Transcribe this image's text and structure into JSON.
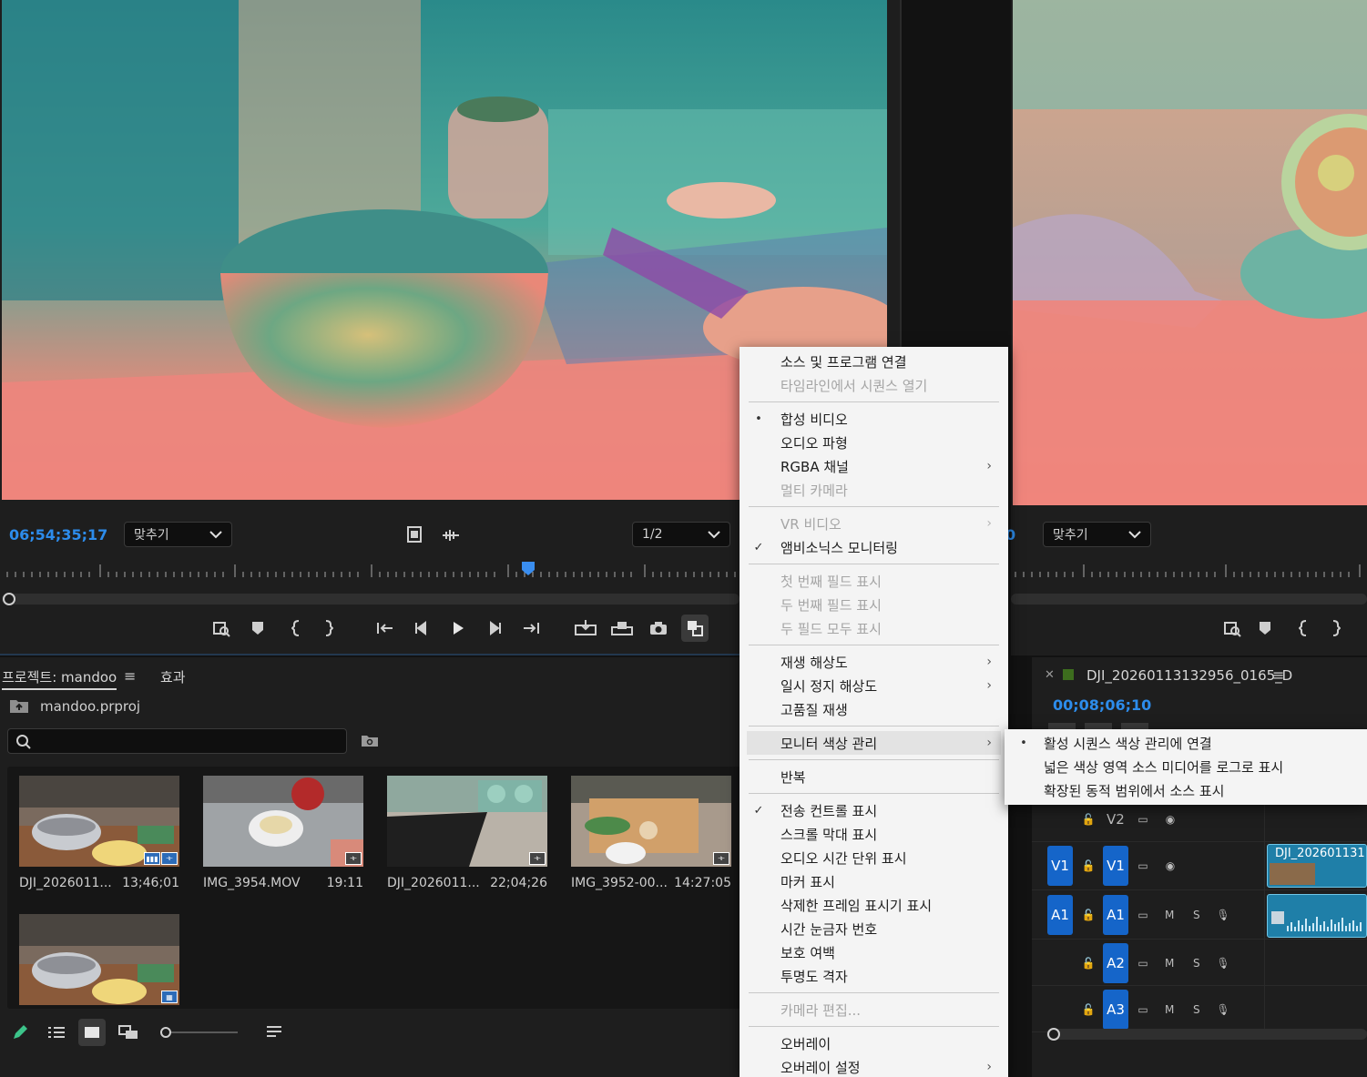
{
  "source_monitor": {
    "timecode": "06;54;35;17",
    "zoom_select": "맞추기",
    "resolution_select": "1/2"
  },
  "program_monitor": {
    "timecode_partial": "0",
    "zoom_select": "맞추기"
  },
  "project_panel": {
    "tab_project": "프로젝트: mandoo",
    "tab_effects": "효과",
    "project_file": "mandoo.prproj",
    "search_placeholder": "",
    "items": [
      {
        "name": "DJI_2026011...",
        "duration": "13;46;01"
      },
      {
        "name": "IMG_3954.MOV",
        "duration": "19:11"
      },
      {
        "name": "DJI_2026011...",
        "duration": "22;04;26"
      },
      {
        "name": "IMG_3952-00...",
        "duration": "14:27:05"
      },
      {
        "name": "",
        "duration": ""
      }
    ]
  },
  "timeline": {
    "sequence_name": "DJI_20260113132956_0165_D",
    "timecode": "00;08;06;10",
    "clip_label": "DJI_202601131",
    "tracks": {
      "v2": "V2",
      "v1_src": "V1",
      "v1": "V1",
      "a1_src": "A1",
      "a1": "A1",
      "a2": "A2",
      "a3": "A3",
      "m": "M",
      "s": "S"
    }
  },
  "context_menu": {
    "items": [
      {
        "label": "소스 및 프로그램 연결"
      },
      {
        "label": "타임라인에서 시퀀스 열기"
      },
      {
        "label": "합성 비디오"
      },
      {
        "label": "오디오 파형"
      },
      {
        "label": "RGBA 채널"
      },
      {
        "label": "멀티 카메라"
      },
      {
        "label": "VR 비디오"
      },
      {
        "label": "앰비소닉스 모니터링"
      },
      {
        "label": "첫 번째 필드 표시"
      },
      {
        "label": "두 번째 필드 표시"
      },
      {
        "label": "두 필드 모두 표시"
      },
      {
        "label": "재생 해상도"
      },
      {
        "label": "일시 정지 해상도"
      },
      {
        "label": "고품질 재생"
      },
      {
        "label": "모니터 색상 관리"
      },
      {
        "label": "반복"
      },
      {
        "label": "전송 컨트롤 표시"
      },
      {
        "label": "스크롤 막대 표시"
      },
      {
        "label": "오디오 시간 단위 표시"
      },
      {
        "label": "마커 표시"
      },
      {
        "label": "삭제한 프레임 표시기 표시"
      },
      {
        "label": "시간 눈금자 번호"
      },
      {
        "label": "보호 여백"
      },
      {
        "label": "투명도 격자"
      },
      {
        "label": "카메라 편집..."
      },
      {
        "label": "오버레이"
      },
      {
        "label": "오버레이 설정"
      }
    ]
  },
  "submenu": {
    "items": [
      {
        "label": "활성 시퀀스 색상 관리에 연결"
      },
      {
        "label": "넓은 색상 영역 소스 미디어를 로그로 표시"
      },
      {
        "label": "확장된 동적 범위에서 소스 표시"
      }
    ]
  }
}
